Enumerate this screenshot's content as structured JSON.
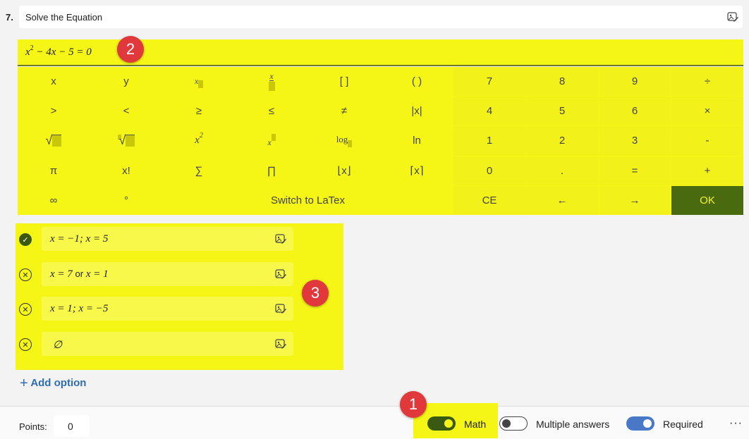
{
  "question": {
    "number": "7.",
    "title": "Solve the Equation"
  },
  "equation": {
    "base": "x",
    "exp": "2",
    "rest": " − 4x − 5 = 0"
  },
  "keys": {
    "r1": [
      "x",
      "y",
      "",
      "",
      "[ ]",
      "( )",
      "7",
      "8",
      "9",
      "÷"
    ],
    "r2": [
      ">",
      "<",
      "≥",
      "≤",
      "≠",
      "|x|",
      "4",
      "5",
      "6",
      "×"
    ],
    "r3": [
      "√",
      "√",
      "x",
      "x",
      "log",
      "ln",
      "1",
      "2",
      "3",
      "-"
    ],
    "r4": [
      "π",
      "x!",
      "∑",
      "∏",
      "⌊x⌋",
      "⌈x⌉",
      "0",
      ".",
      "=",
      "+"
    ],
    "r5": [
      "∞",
      "°",
      "Switch to LaTex",
      "CE",
      "←",
      "→",
      "OK"
    ],
    "sup2": "2"
  },
  "options": [
    {
      "text": "x = −1; x = 5",
      "correct": true
    },
    {
      "pre": "x = 7 ",
      "or": "or",
      "post": " x = 1",
      "correct": false
    },
    {
      "text": "x = 1; x = −5",
      "correct": false
    },
    {
      "text": "∅",
      "correct": false
    }
  ],
  "add_option": "Add option",
  "badges": [
    "1",
    "2",
    "3"
  ],
  "footer": {
    "points_label": "Points:",
    "points_value": "0",
    "math_label": "Math",
    "multiple_label": "Multiple answers",
    "required_label": "Required",
    "more": "···"
  },
  "colors": {
    "highlight": "#f5f516",
    "ok_button": "#4a6a10",
    "link": "#2f6cb5",
    "toggle_on": "#4a78c8",
    "badge": "#e0383b"
  }
}
